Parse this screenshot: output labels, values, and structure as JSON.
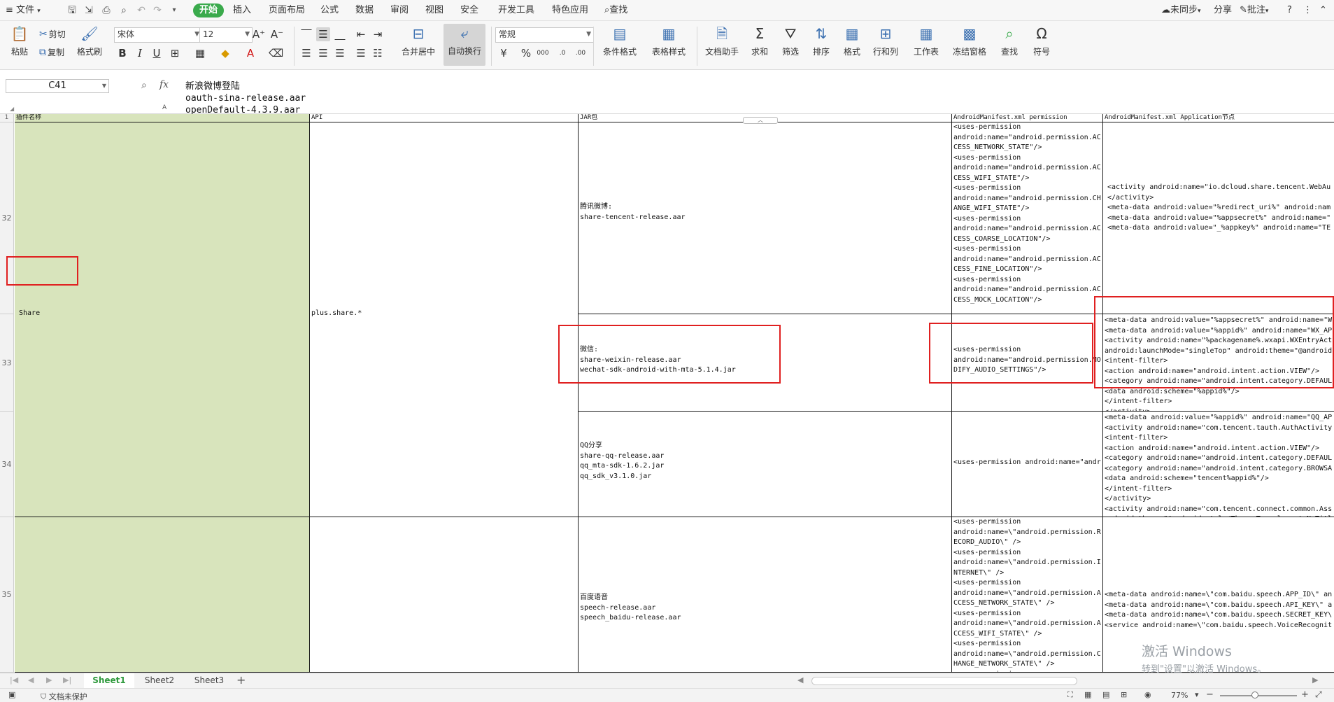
{
  "menu": {
    "file": "文件",
    "tabs": [
      "开始",
      "插入",
      "页面布局",
      "公式",
      "数据",
      "审阅",
      "视图",
      "安全",
      "开发工具",
      "特色应用"
    ],
    "search": "查找",
    "unsynced": "未同步",
    "share": "分享",
    "comment": "批注",
    "help": "?"
  },
  "ribbon": {
    "paste": "粘贴",
    "cut": "剪切",
    "copy": "复制",
    "format_painter": "格式刷",
    "font_name": "宋体",
    "font_size": "12",
    "merge_center": "合并居中",
    "wrap_text": "自动换行",
    "number_format": "常规",
    "conditional_format": "条件格式",
    "table_style": "表格样式",
    "doc_assistant": "文档助手",
    "sum": "求和",
    "filter": "筛选",
    "sort": "排序",
    "format": "格式",
    "row_col": "行和列",
    "worksheet": "工作表",
    "freeze": "冻结窗格",
    "find": "查找",
    "symbol": "符号"
  },
  "formula_bar": {
    "cell_ref": "C41",
    "fx": "fx",
    "content": "新浪微博登陆\noauth-sina-release.aar\nopenDefault-4.3.9.aar"
  },
  "grid": {
    "col_a": "A",
    "headers": [
      "插件名称",
      "API",
      "JAR包",
      "AndroidManifest.xml permission",
      "AndroidManifest.xml Application节点"
    ],
    "row_numbers": [
      "1",
      "32",
      "33",
      "34",
      "35"
    ],
    "plugin_name": "Share",
    "api": "plus.share.*",
    "jar_tencent": "腾讯微博:\nshare-tencent-release.aar",
    "jar_weixin": "微信:\nshare-weixin-release.aar\nwechat-sdk-android-with-mta-5.1.4.jar",
    "jar_qq": "QQ分享\nshare-qq-release.aar\nqq_mta-sdk-1.6.2.jar\nqq_sdk_v3.1.0.jar",
    "jar_baidu": "百度语音\nspeech-release.aar\nspeech_baidu-release.aar",
    "perm_32": "<uses-permission\nandroid:name=\"android.permission.AC\nCESS_NETWORK_STATE\"/>\n<uses-permission\nandroid:name=\"android.permission.AC\nCESS_WIFI_STATE\"/>\n<uses-permission\nandroid:name=\"android.permission.CH\nANGE_WIFI_STATE\"/>\n<uses-permission\nandroid:name=\"android.permission.AC\nCESS_COARSE_LOCATION\"/>\n<uses-permission\nandroid:name=\"android.permission.AC\nCESS_FINE_LOCATION\"/>\n<uses-permission\nandroid:name=\"android.permission.AC\nCESS_MOCK_LOCATION\"/>",
    "perm_33": "<uses-permission\nandroid:name=\"android.permission.MO\nDIFY_AUDIO_SETTINGS\"/>",
    "perm_34": "<uses-permission android:name=\"andr",
    "perm_35": "<uses-permission\nandroid:name=\\\"android.permission.R\nECORD_AUDIO\\\" />\n<uses-permission\nandroid:name=\\\"android.permission.I\nNTERNET\\\" />\n<uses-permission\nandroid:name=\\\"android.permission.A\nCCESS_NETWORK_STATE\\\" />\n<uses-permission\nandroid:name=\\\"android.permission.A\nCCESS_WIFI_STATE\\\" />\n<uses-permission\nandroid:name=\\\"android.permission.C\nHANGE_NETWORK_STATE\\\" />\n<uses-permission",
    "app_32": "<activity android:name=\"io.dcloud.share.tencent.WebAu\n</activity>\n<meta-data android:value=\"%redirect_uri%\" android:nam\n<meta-data android:value=\"%appsecret%\" android:name=\"\n<meta-data android:value=\"_%appkey%\" android:name=\"TE",
    "app_33": "<meta-data android:value=\"%appsecret%\" android:name=\"W\n<meta-data android:value=\"%appid%\" android:name=\"WX_AP\n<activity android:name=\"%packagename%.wxapi.WXEntryAct\nandroid:launchMode=\"singleTop\" android:theme=\"@android\n<intent-filter>\n<action android:name=\"android.intent.action.VIEW\"/>\n<category android:name=\"android.intent.category.DEFAUL\n<data android:scheme=\"%appid%\"/>\n</intent-filter>\n</activity>",
    "app_34": "<meta-data android:value=\"%appid%\" android:name=\"QQ_AP\n<activity android:name=\"com.tencent.tauth.AuthActivity\n<intent-filter>\n<action android:name=\"android.intent.action.VIEW\"/>\n<category android:name=\"android.intent.category.DEFAUL\n<category android:name=\"android.intent.category.BROWSA\n<data android:scheme=\"tencent%appid%\"/>\n</intent-filter>\n</activity>\n<activity android:name=\"com.tencent.connect.common.Ass\nandroid:theme=\"@android:style/Theme.Translucent.NoTitl",
    "app_35": "<meta-data android:name=\\\"com.baidu.speech.APP_ID\\\" an\n<meta-data android:name=\\\"com.baidu.speech.API_KEY\\\" a\n<meta-data android:name=\\\"com.baidu.speech.SECRET_KEY\\\n<service android:name=\\\"com.baidu.speech.VoiceRecognit"
  },
  "watermark": {
    "line1": "激活 Windows",
    "line2": "转到\"设置\"以激活 Windows。"
  },
  "sheets": [
    "Sheet1",
    "Sheet2",
    "Sheet3"
  ],
  "status": {
    "protect": "文档未保护",
    "zoom": "77%"
  },
  "colors": {
    "accent_green": "#3aaa4c",
    "cell_green": "#d8e4bc",
    "highlight_red": "#e02020"
  }
}
